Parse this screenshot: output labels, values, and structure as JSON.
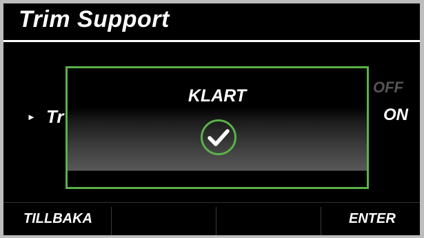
{
  "header": {
    "title": "Trim Support"
  },
  "menu": {
    "row_label": "Tr",
    "options": [
      "OFF",
      "ON"
    ]
  },
  "dialog": {
    "message": "KLART",
    "icon": "checkmark-circle-icon",
    "accent_color": "#5ab247"
  },
  "footer": {
    "back_label": "TILLBAKA",
    "enter_label": "ENTER"
  }
}
